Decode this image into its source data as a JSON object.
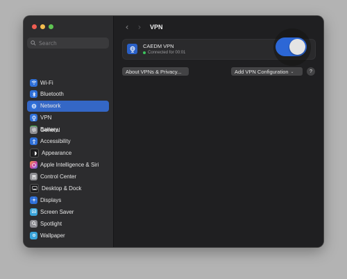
{
  "search": {
    "placeholder": "Search"
  },
  "sidebar": {
    "group1": [
      {
        "label": "Wi-Fi",
        "icon": "wifi-icon",
        "color": "#2e6fd8"
      },
      {
        "label": "Bluetooth",
        "icon": "bluetooth-icon",
        "color": "#2e6fd8"
      },
      {
        "label": "Network",
        "icon": "globe-icon",
        "color": "#2e6fd8",
        "selected": true
      },
      {
        "label": "VPN",
        "icon": "vpn-icon",
        "color": "#2e6fd8"
      },
      {
        "label": "Battery",
        "icon": "battery-icon",
        "color": "#3fae44"
      }
    ],
    "group2": [
      {
        "label": "General",
        "icon": "gear-icon",
        "color": "#8e8e93"
      },
      {
        "label": "Accessibility",
        "icon": "accessibility-icon",
        "color": "#2e6fd8"
      },
      {
        "label": "Appearance",
        "icon": "appearance-icon",
        "color": "#1c1c1e"
      },
      {
        "label": "Apple Intelligence & Siri",
        "icon": "siri-icon",
        "color": "#c45ad4"
      },
      {
        "label": "Control Center",
        "icon": "control-center-icon",
        "color": "#8e8e93"
      },
      {
        "label": "Desktop & Dock",
        "icon": "dock-icon",
        "color": "#1c1c1e"
      },
      {
        "label": "Displays",
        "icon": "displays-icon",
        "color": "#2e6fd8"
      },
      {
        "label": "Screen Saver",
        "icon": "screen-saver-icon",
        "color": "#3aa3d8"
      },
      {
        "label": "Spotlight",
        "icon": "spotlight-icon",
        "color": "#8e8e93"
      },
      {
        "label": "Wallpaper",
        "icon": "wallpaper-icon",
        "color": "#3aa3d8"
      }
    ]
  },
  "main": {
    "title": "VPN",
    "vpn": {
      "name": "CAEDM VPN",
      "status": "Connected for 00:01",
      "enabled": true
    },
    "about_label": "About VPNs & Privacy...",
    "add_label": "Add VPN Configuration",
    "help_label": "?"
  },
  "colors": {
    "accent": "#2c67d6",
    "selection": "#3467c6",
    "connected": "#3cc45e"
  }
}
